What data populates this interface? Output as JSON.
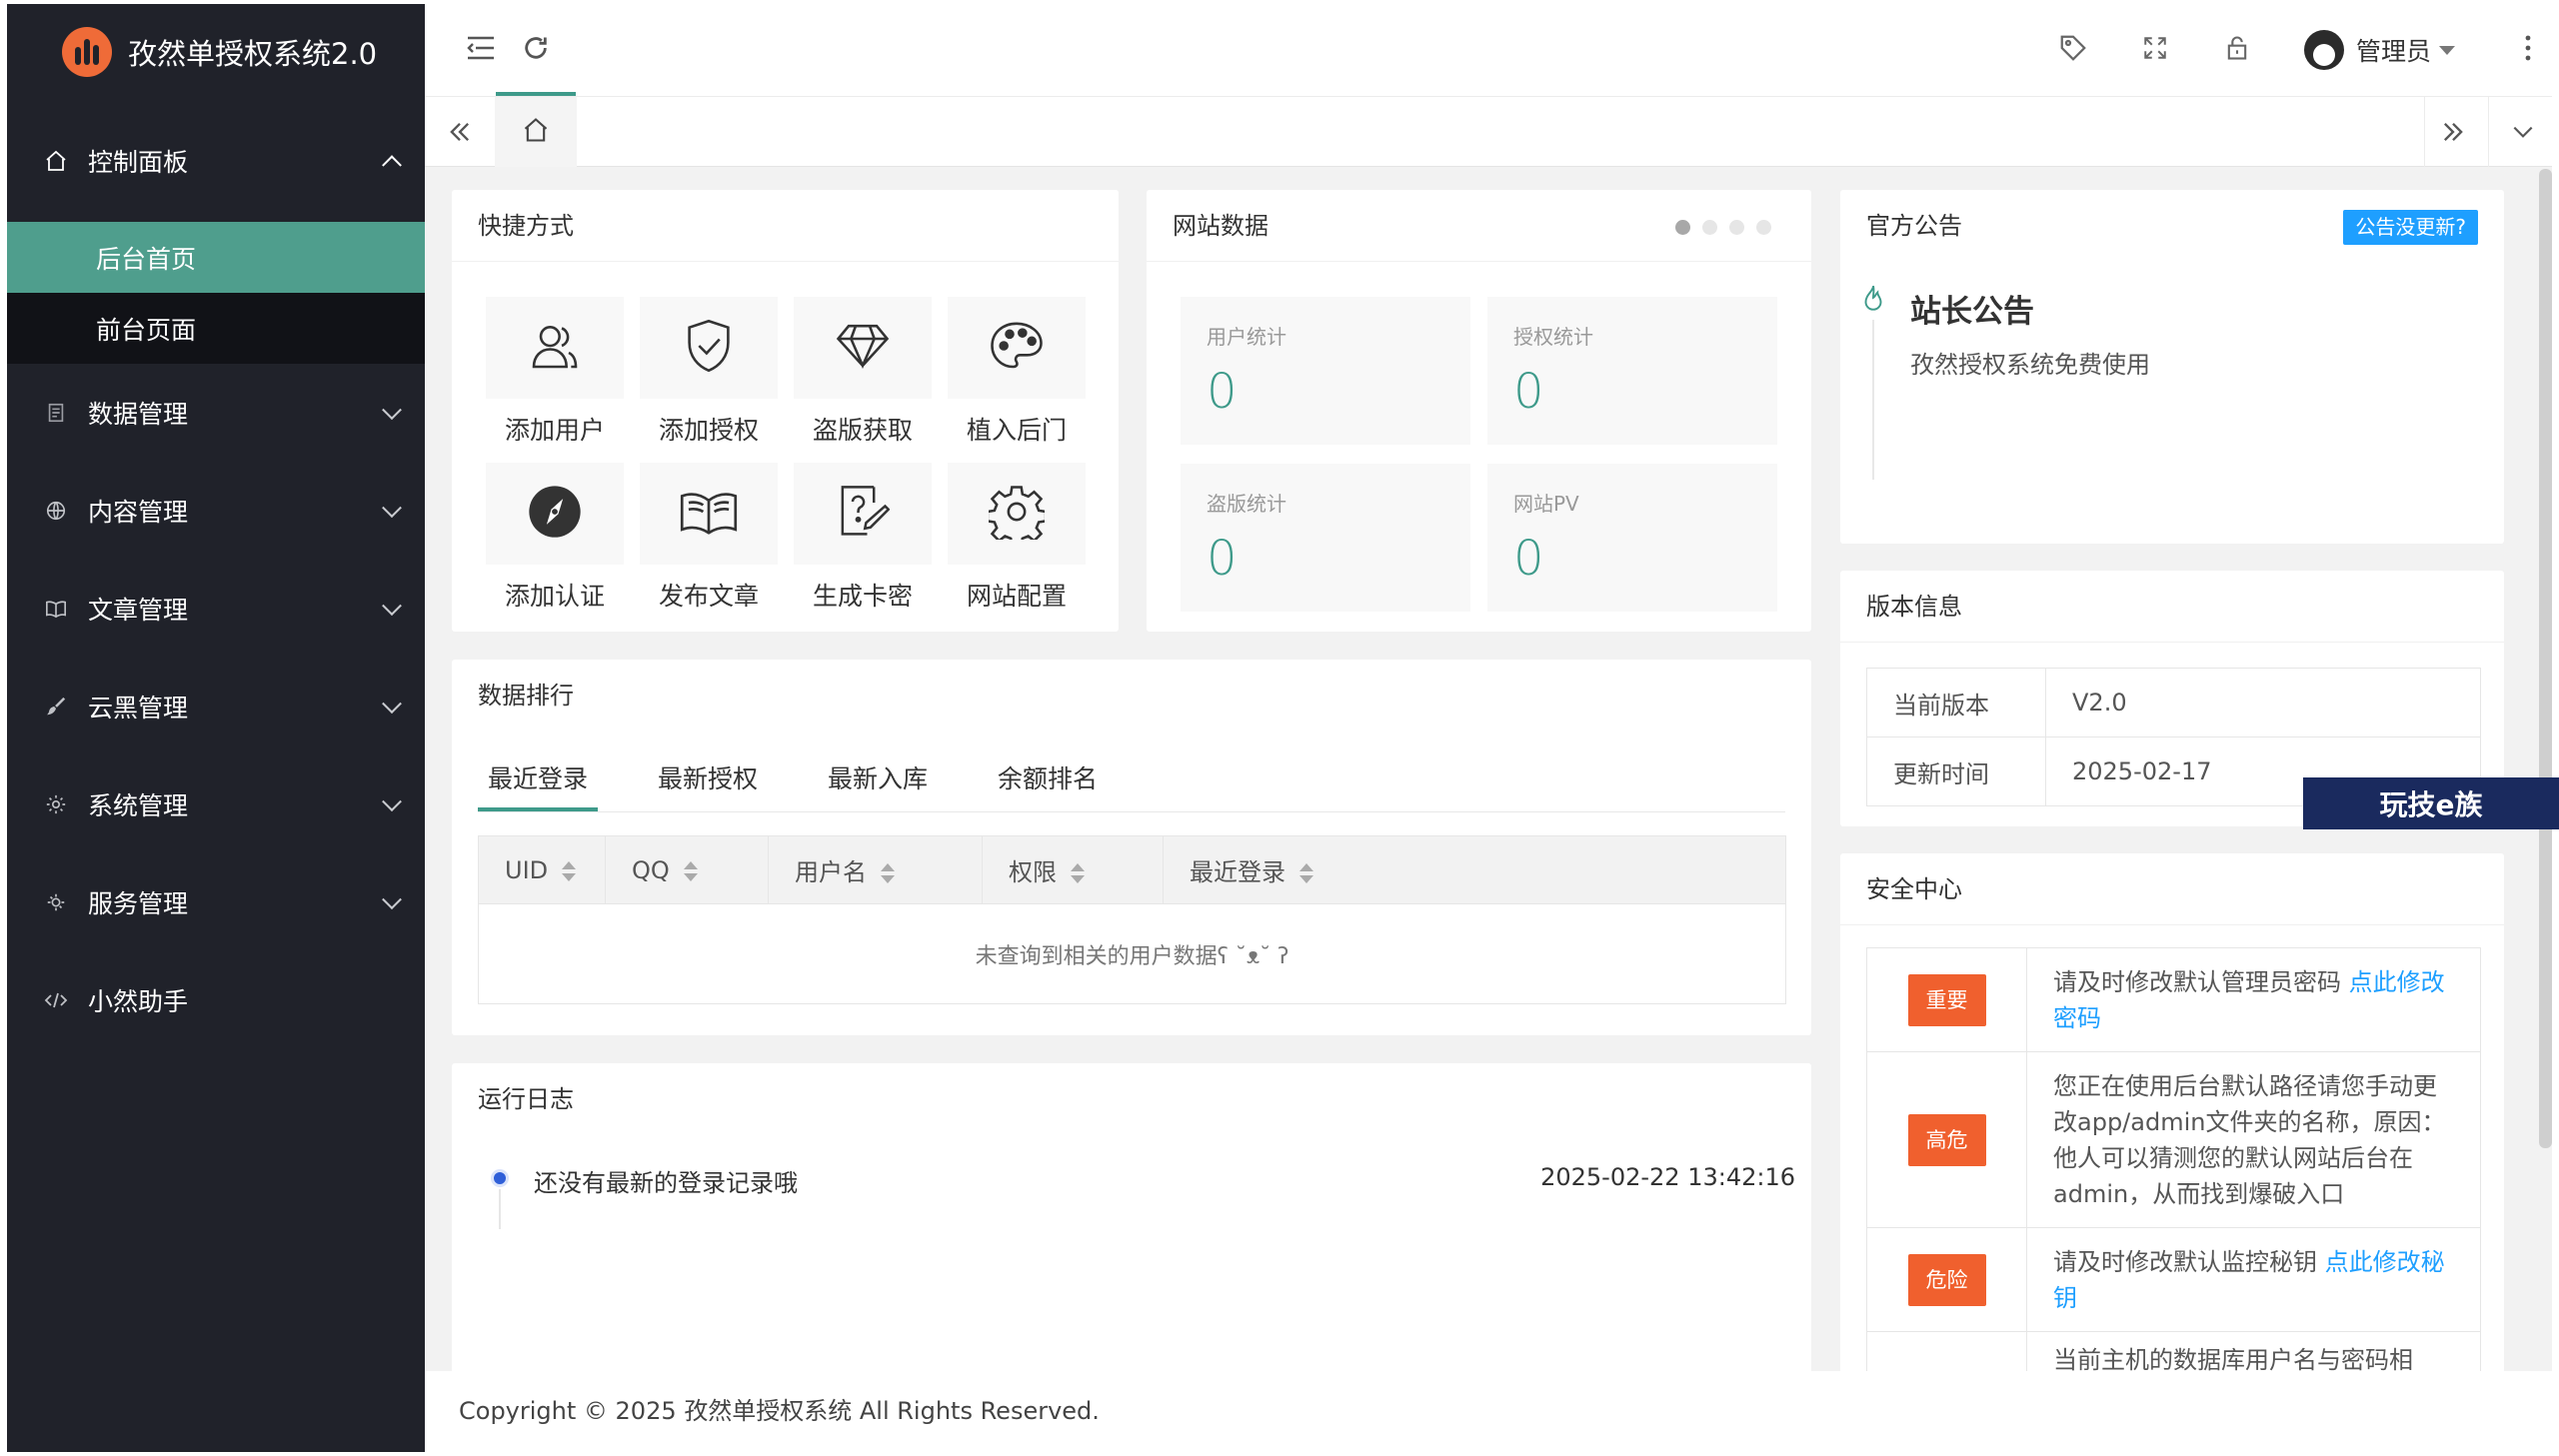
{
  "app": {
    "title": "孜然单授权系统2.0"
  },
  "sidebar": {
    "items": [
      {
        "label": "控制面板",
        "icon": "home-icon"
      },
      {
        "label": "数据管理",
        "icon": "document-icon"
      },
      {
        "label": "内容管理",
        "icon": "globe-icon"
      },
      {
        "label": "文章管理",
        "icon": "book-icon"
      },
      {
        "label": "云黑管理",
        "icon": "brush-icon"
      },
      {
        "label": "系统管理",
        "icon": "gear-icon"
      },
      {
        "label": "服务管理",
        "icon": "service-icon"
      },
      {
        "label": "小然助手",
        "icon": "code-icon"
      }
    ],
    "sub_items": [
      {
        "label": "后台首页"
      },
      {
        "label": "前台页面"
      }
    ]
  },
  "header": {
    "admin_label": "管理员"
  },
  "shortcuts": {
    "title": "快捷方式",
    "items": [
      {
        "label": "添加用户",
        "icon": "users-icon"
      },
      {
        "label": "添加授权",
        "icon": "shield-check-icon"
      },
      {
        "label": "盗版获取",
        "icon": "diamond-icon"
      },
      {
        "label": "植入后门",
        "icon": "palette-icon"
      },
      {
        "label": "添加认证",
        "icon": "compass-icon"
      },
      {
        "label": "发布文章",
        "icon": "open-book-icon"
      },
      {
        "label": "生成卡密",
        "icon": "help-edit-icon"
      },
      {
        "label": "网站配置",
        "icon": "gear-icon"
      }
    ]
  },
  "site_data": {
    "title": "网站数据",
    "stats": [
      {
        "label": "用户统计",
        "value": "0"
      },
      {
        "label": "授权统计",
        "value": "0"
      },
      {
        "label": "盗版统计",
        "value": "0"
      },
      {
        "label": "网站PV",
        "value": "0"
      }
    ]
  },
  "notice": {
    "title": "官方公告",
    "button": "公告没更新?",
    "heading": "站长公告",
    "text": "孜然授权系统免费使用"
  },
  "version": {
    "title": "版本信息",
    "rows": [
      {
        "key": "当前版本",
        "value": "V2.0"
      },
      {
        "key": "更新时间",
        "value": "2025-02-17"
      }
    ]
  },
  "ranking": {
    "title": "数据排行",
    "tabs": [
      "最近登录",
      "最新授权",
      "最新入库",
      "余额排名"
    ],
    "columns": [
      "UID",
      "QQ",
      "用户名",
      "权限",
      "最近登录"
    ],
    "empty": "未查询到相关的用户数据ʕ ˘ᴥ˘ ʔ"
  },
  "log": {
    "title": "运行日志",
    "entries": [
      {
        "text": "还没有最新的登录记录哦",
        "time": "2025-02-22 13:42:16"
      }
    ]
  },
  "security": {
    "title": "安全中心",
    "rows": [
      {
        "badge": "重要",
        "color": "#f0602e",
        "text": "请及时修改默认管理员密码 ",
        "link": "点此修改密码"
      },
      {
        "badge": "高危",
        "color": "#f0602e",
        "text": "您正在使用后台默认路径请您手动更改app/admin文件夹的名称，原因：他人可以猜测您的默认网站后台在admin，从而找到爆破入口",
        "link": ""
      },
      {
        "badge": "危险",
        "color": "#f0602e",
        "text": "请及时修改默认监控秘钥 ",
        "link": "点此修改秘钥"
      },
      {
        "badge": "",
        "color": "#f0602e",
        "text": "当前主机的数据库用户名与密码相",
        "link": ""
      }
    ]
  },
  "footer": {
    "text": "Copyright © 2025 孜然单授权系统 All Rights Reserved."
  },
  "watermark": {
    "text": "玩技e族"
  },
  "colors": {
    "sidebar": "#20222a",
    "accent": "#3e9a8a",
    "link": "#1e9fff",
    "danger": "#f0602e"
  }
}
